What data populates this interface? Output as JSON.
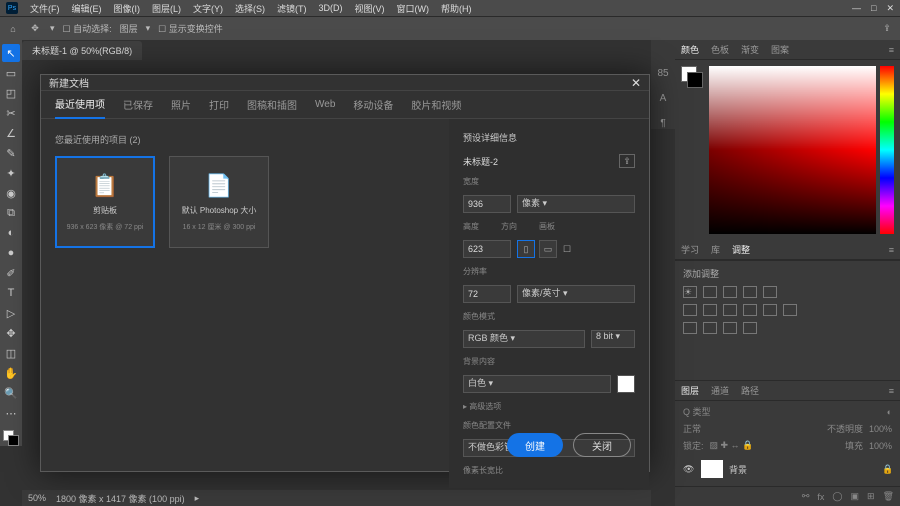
{
  "menu": {
    "items": [
      "文件(F)",
      "编辑(E)",
      "图像(I)",
      "图层(L)",
      "文字(Y)",
      "选择(S)",
      "滤镜(T)",
      "3D(D)",
      "视图(V)",
      "窗口(W)",
      "帮助(H)"
    ]
  },
  "optbar": {
    "autoSelectLabel": "自动选择:",
    "groupLabel": "图层",
    "transformLabel": "显示变换控件"
  },
  "doctab": "未标题-1 @ 50%(RGB/8)",
  "tools": [
    "↖",
    "▭",
    "◰",
    "✂",
    "∠",
    "✎",
    "✦",
    "◉",
    "⧉",
    "◐",
    "●",
    "✐",
    "T",
    "▷",
    "✥",
    "◫",
    "◯",
    "✋",
    "🔍",
    "⋯"
  ],
  "miniIcons": [
    "85",
    "A",
    "¶"
  ],
  "colorPanel": {
    "tabs": [
      "颜色",
      "色板",
      "渐变",
      "图案"
    ],
    "active": "颜色"
  },
  "propPanel": {
    "tabs": [
      "学习",
      "库",
      "调整"
    ],
    "active": "调整",
    "hint": "添加调整"
  },
  "layersPanel": {
    "tabs": [
      "图层",
      "通道",
      "路径"
    ],
    "active": "图层",
    "kind": "Q 类型",
    "blend": "正常",
    "opacityLabel": "不透明度",
    "opacity": "100%",
    "lockLabel": "锁定:",
    "fillLabel": "填充",
    "fill": "100%",
    "layerName": "背景"
  },
  "status": {
    "zoom": "50%",
    "info": "1800 像素 x 1417 像素 (100 ppi)"
  },
  "dialog": {
    "title": "新建文档",
    "tabs": [
      "最近使用项",
      "已保存",
      "照片",
      "打印",
      "图稿和插图",
      "Web",
      "移动设备",
      "胶片和视频"
    ],
    "activeTab": "最近使用项",
    "recentLabel": "您最近使用的项目 (2)",
    "presets": [
      {
        "name": "剪贴板",
        "meta": "936 x 623 像素 @ 72 ppi",
        "selected": true,
        "icon": "📋"
      },
      {
        "name": "默认 Photoshop 大小",
        "meta": "16 x 12 厘米 @ 300 ppi",
        "selected": false,
        "icon": "📄"
      }
    ],
    "detailsHeader": "预设详细信息",
    "docName": "未标题-2",
    "widthLabel": "宽度",
    "width": "936",
    "unit": "像素",
    "heightLabel": "高度",
    "height": "623",
    "orientLabel": "方向",
    "artboardLabel": "画板",
    "resLabel": "分辨率",
    "res": "72",
    "resUnit": "像素/英寸",
    "colorModeLabel": "颜色模式",
    "colorMode": "RGB 颜色",
    "bits": "8 bit",
    "bgLabel": "背景内容",
    "bg": "白色",
    "advLabel": "▸ 高级选项",
    "profileLabel": "颜色配置文件",
    "profile": "不做色彩管理",
    "pixelAspectLabel": "像素长宽比",
    "createBtn": "创建",
    "closeBtn": "关闭"
  }
}
